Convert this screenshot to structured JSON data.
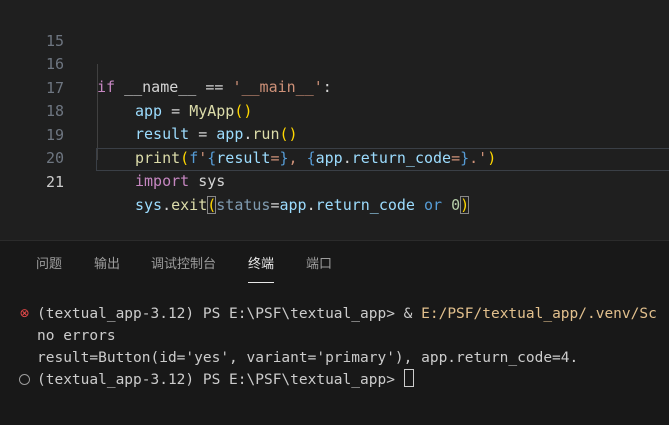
{
  "editor": {
    "lines": [
      {
        "num": "15"
      },
      {
        "num": "16"
      },
      {
        "num": "17"
      },
      {
        "num": "18"
      },
      {
        "num": "19"
      },
      {
        "num": "20"
      },
      {
        "num": "21"
      }
    ],
    "l16": {
      "if": "if",
      "name": "__name__",
      "eq": " == ",
      "str": "'__main__'",
      "colon": ":"
    },
    "l17": {
      "var": "app",
      "eq": " = ",
      "cls": "MyApp",
      "open": "(",
      "close": ")"
    },
    "l18": {
      "var": "result",
      "eq": " = ",
      "obj": "app",
      "dot": ".",
      "fn": "run",
      "open": "(",
      "close": ")"
    },
    "l19": {
      "fn": "print",
      "open": "(",
      "f": "f",
      "q1": "'",
      "b1o": "{",
      "v1": "result",
      "e1": "=",
      "b1c": "}",
      "sep": ", ",
      "b2o": "{",
      "v2a": "app",
      "dot": ".",
      "v2b": "return_code",
      "e2": "=",
      "b2c": "}",
      "tail": ".'",
      "close": ")"
    },
    "l20": {
      "import": "import",
      "mod": " sys"
    },
    "l21": {
      "obj": "sys",
      "dot": ".",
      "fn": "exit",
      "open": "(",
      "kwarg": "status",
      "eq": "=",
      "v1": "app",
      "dot2": ".",
      "v2": "return_code",
      "or": " or ",
      "num": "0",
      "close": ")"
    }
  },
  "panel": {
    "tabs": [
      {
        "label": "问题"
      },
      {
        "label": "输出"
      },
      {
        "label": "调试控制台"
      },
      {
        "label": "终端"
      },
      {
        "label": "端口"
      }
    ],
    "active_tab": "终端"
  },
  "terminal": {
    "line1_prompt": "(textual_app-3.12) PS E:\\PSF\\textual_app> ",
    "line1_amp": "& ",
    "line1_path": "E:/PSF/textual_app/.venv/Sc",
    "line2": "no errors",
    "line3": "result=Button(id='yes', variant='primary'), app.return_code=4.",
    "line4_prompt": "(textual_app-3.12) PS E:\\PSF\\textual_app> "
  },
  "colors": {
    "background": "#1f1f1f",
    "error_icon": "#f14c4c",
    "keyword": "#569cd6",
    "string": "#ce9178",
    "function": "#dcdcaa"
  },
  "icons": {
    "error": "error-circle-icon",
    "success": "circle-outline-icon"
  }
}
